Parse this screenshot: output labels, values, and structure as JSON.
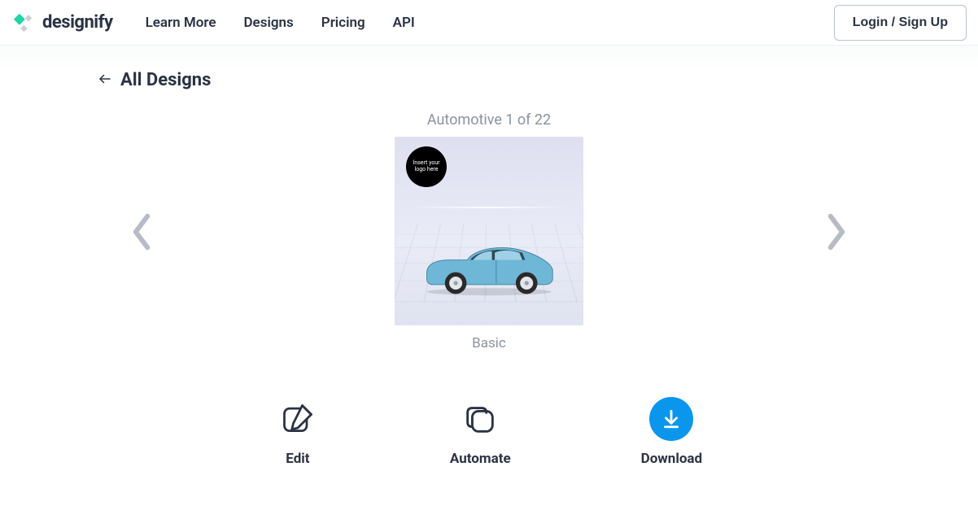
{
  "brand": "designify",
  "nav": {
    "learn_more": "Learn More",
    "designs": "Designs",
    "pricing": "Pricing",
    "api": "API"
  },
  "login_label": "Login / Sign Up",
  "back_label": "All Designs",
  "design": {
    "counter": "Automotive 1 of 22",
    "caption": "Basic",
    "badge_text": "Insert your logo here"
  },
  "actions": {
    "edit": "Edit",
    "automate": "Automate",
    "download": "Download"
  }
}
